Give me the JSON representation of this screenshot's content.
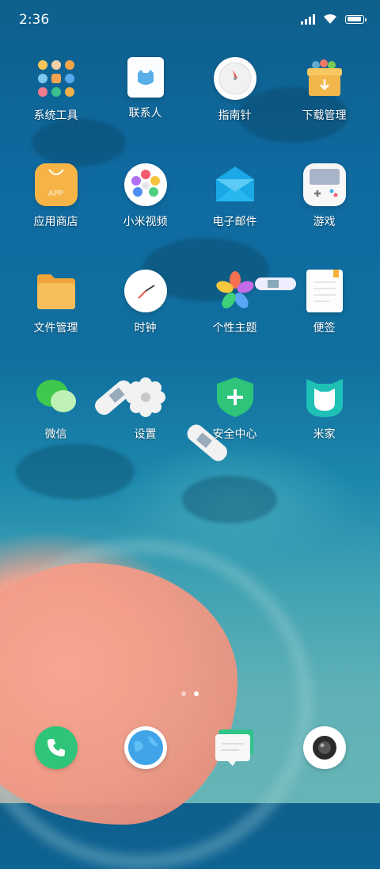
{
  "status_bar": {
    "time": "2:36"
  },
  "apps": [
    {
      "name": "系统工具",
      "icon": "tools-folder-icon"
    },
    {
      "name": "联系人",
      "icon": "contacts-icon"
    },
    {
      "name": "指南针",
      "icon": "compass-icon"
    },
    {
      "name": "下载管理",
      "icon": "download-box-icon"
    },
    {
      "name": "应用商店",
      "icon": "app-store-bag-icon",
      "badge_text": "APP"
    },
    {
      "name": "小米视频",
      "icon": "video-dots-icon"
    },
    {
      "name": "电子邮件",
      "icon": "mail-envelope-icon"
    },
    {
      "name": "游戏",
      "icon": "gamepad-icon"
    },
    {
      "name": "文件管理",
      "icon": "folder-icon"
    },
    {
      "name": "时钟",
      "icon": "clock-icon"
    },
    {
      "name": "个性主题",
      "icon": "themes-flower-icon"
    },
    {
      "name": "便签",
      "icon": "notes-icon"
    },
    {
      "name": "微信",
      "icon": "wechat-icon"
    },
    {
      "name": "设置",
      "icon": "settings-gear-icon"
    },
    {
      "name": "安全中心",
      "icon": "security-shield-icon"
    },
    {
      "name": "米家",
      "icon": "mijia-icon"
    }
  ],
  "page_indicator": {
    "count": 2,
    "current": 2
  },
  "dock": [
    {
      "icon": "phone-icon"
    },
    {
      "icon": "browser-globe-icon"
    },
    {
      "icon": "messages-icon"
    },
    {
      "icon": "camera-icon"
    }
  ],
  "colors": {
    "sea": "#0f6aa0",
    "sand": "#f29b8a",
    "green": "#2ec47a"
  }
}
